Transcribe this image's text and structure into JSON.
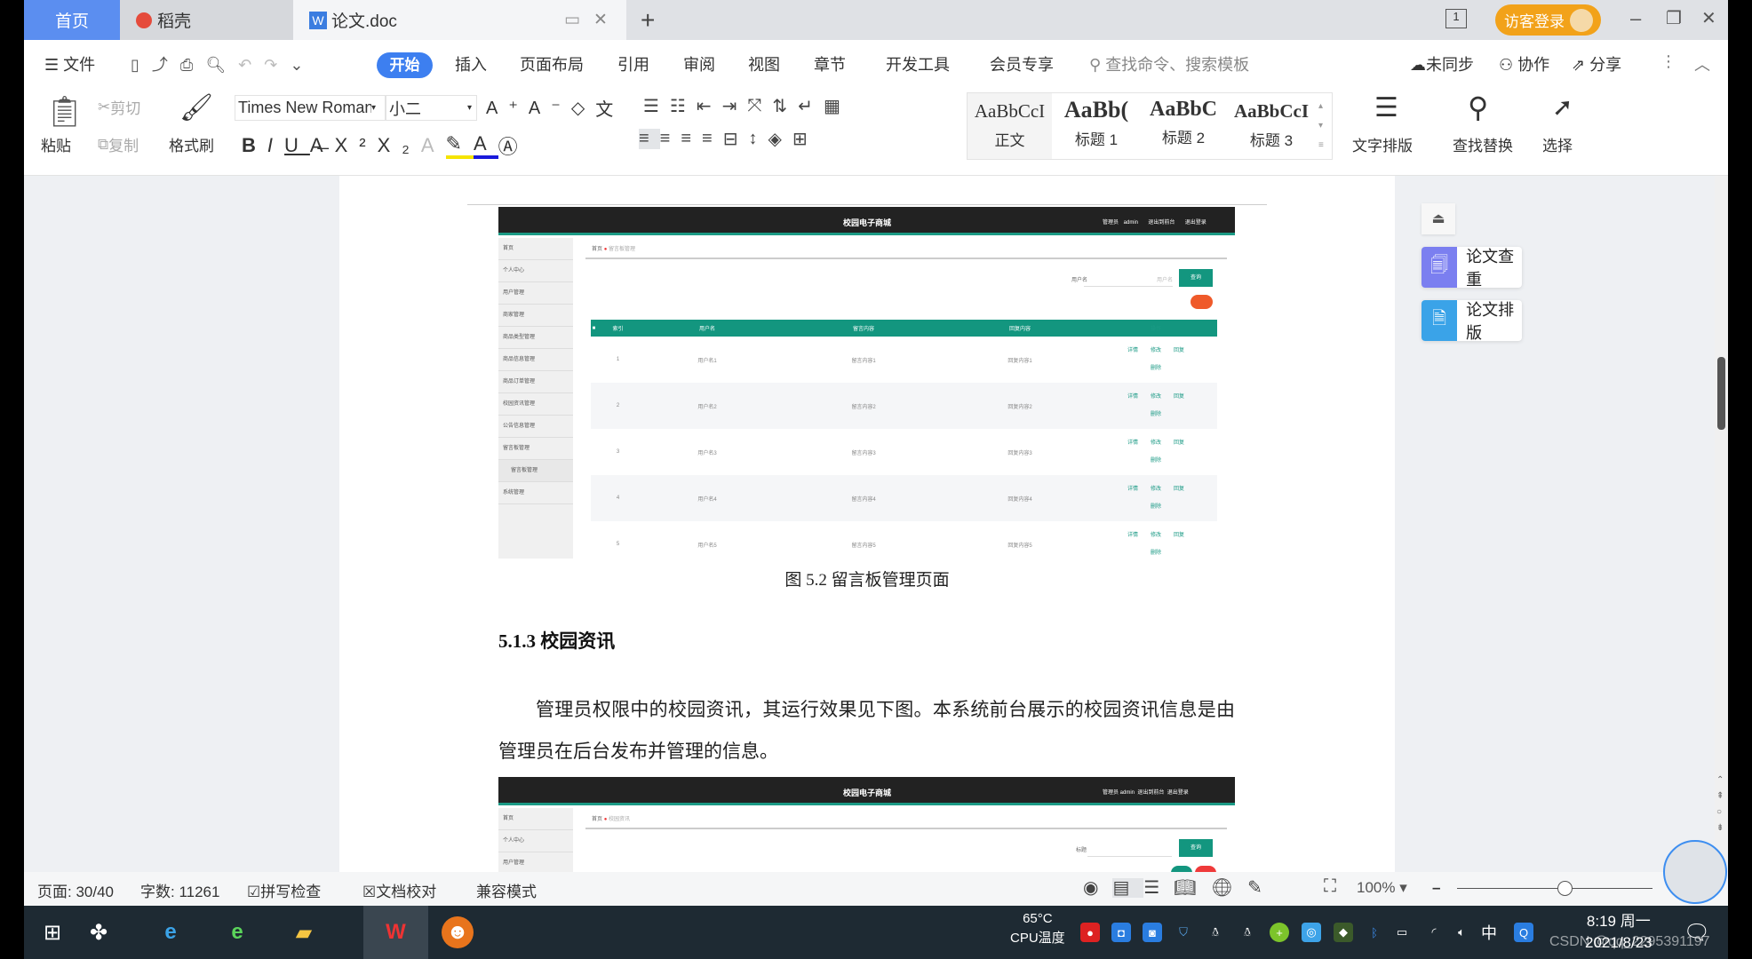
{
  "tabs": [
    {
      "label": "首页"
    },
    {
      "label": "稻壳"
    },
    {
      "label": "论文.doc"
    }
  ],
  "titlebar": {
    "new_tab": "+",
    "page_count_icon": "1",
    "guest_login": "访客登录",
    "minimize": "–",
    "restore": "❐",
    "close": "✕"
  },
  "menu": {
    "file": "文件",
    "items": [
      "开始",
      "插入",
      "页面布局",
      "引用",
      "审阅",
      "视图",
      "章节",
      "开发工具",
      "会员专享"
    ],
    "search_placeholder": "查找命令、搜索模板",
    "sync": "未同步",
    "collab": "协作",
    "share": "分享"
  },
  "ribbon": {
    "paste": "粘贴",
    "cut": "剪切",
    "copy": "复制",
    "format_painter": "格式刷",
    "font_name": "Times New Roman",
    "font_size": "小二",
    "styles": [
      {
        "preview": "AaBbCcI",
        "label": "正文"
      },
      {
        "preview": "AaBb(",
        "label": "标题 1"
      },
      {
        "preview": "AaBbC",
        "label": "标题 2"
      },
      {
        "preview": "AaBbCcI",
        "label": "标题 3"
      }
    ],
    "text_layout": "文字排版",
    "find_replace": "查找替换",
    "select": "选择"
  },
  "document": {
    "shot1": {
      "app_title": "校园电子商城",
      "admin": "管理员 admin",
      "to_front": "退出到前台",
      "logout": "退出登录",
      "sidebar": [
        "首页",
        "个人中心",
        "用户管理",
        "商家管理",
        "商品类型管理",
        "商品信息管理",
        "商品订单管理",
        "校园资讯管理",
        "公告信息管理",
        "留言板管理",
        "留言板管理",
        "系统管理"
      ],
      "breadcrumb": [
        "首页",
        "留言板管理"
      ],
      "search_label": "用户名",
      "search_placeholder": "用户名",
      "search_button": "查询",
      "columns": [
        "索引",
        "用户名",
        "留言内容",
        "回复内容",
        "操作"
      ],
      "rows": [
        [
          "1",
          "用户名1",
          "留言内容1",
          "回复内容1"
        ],
        [
          "2",
          "用户名2",
          "留言内容2",
          "回复内容2"
        ],
        [
          "3",
          "用户名3",
          "留言内容3",
          "回复内容3"
        ],
        [
          "4",
          "用户名4",
          "留言内容4",
          "回复内容4"
        ],
        [
          "5",
          "用户名5",
          "留言内容5",
          "回复内容5"
        ]
      ],
      "actions": [
        "详情",
        "修改",
        "回复",
        "删除"
      ]
    },
    "caption": "图 5.2  留言板管理页面",
    "heading": "5.1.3  校园资讯",
    "paragraph": "管理员权限中的校园资讯，其运行效果见下图。本系统前台展示的校园资讯信息是由管理员在后台发布并管理的信息。",
    "shot2": {
      "app_title": "校园电子商城",
      "admin": "管理员 admin",
      "to_front": "退出到前台",
      "logout": "退出登录",
      "sidebar": [
        "首页",
        "个人中心",
        "用户管理"
      ],
      "breadcrumb": [
        "首页",
        "校园资讯"
      ],
      "search_label": "标题",
      "search_button": "查询"
    }
  },
  "right_panel": {
    "check": "论文查重",
    "layout": "论文排版",
    "check_color": "#7b7ff0",
    "layout_color": "#3aa3e8"
  },
  "status": {
    "page": "页面: 30/40",
    "words": "字数: 11261",
    "spell": "拼写检查",
    "proof": "文档校对",
    "compat": "兼容模式",
    "zoom": "100%",
    "zoom_level": 100
  },
  "taskbar": {
    "cpu_temp": "65°C",
    "cpu_label": "CPU温度",
    "ime": "中",
    "time": "8:19 周一",
    "date": "2021/8/23",
    "watermark": "CSDN @qq_2295391197"
  }
}
